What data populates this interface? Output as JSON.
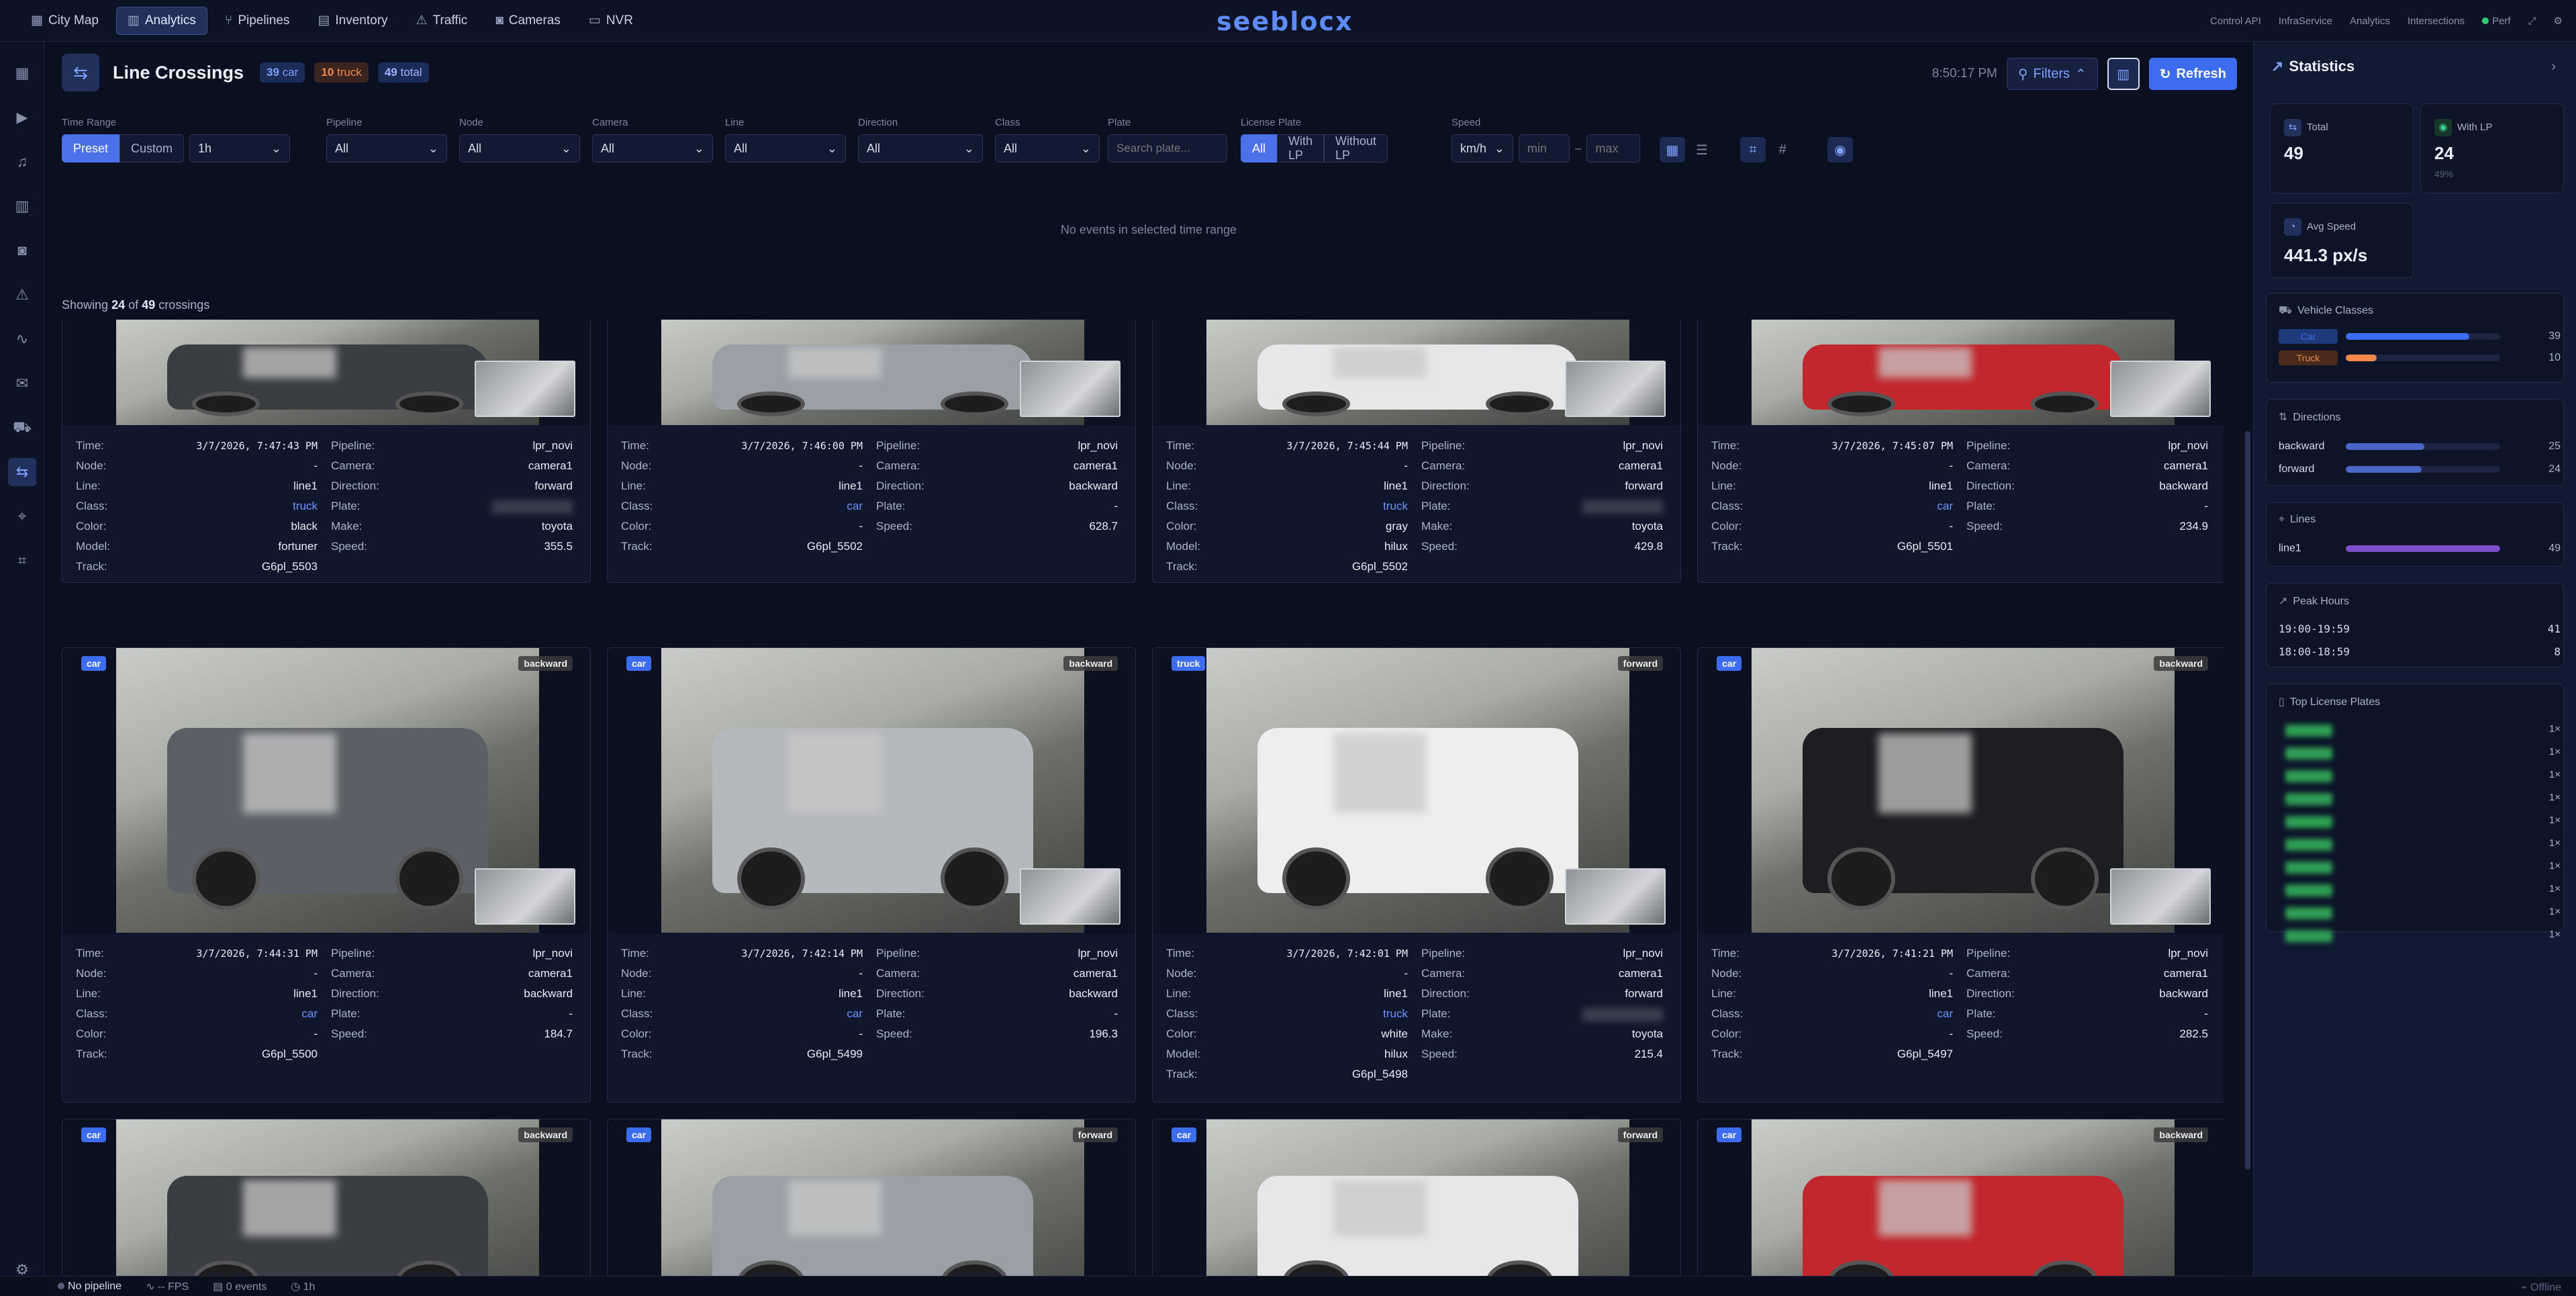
{
  "nav": {
    "items": [
      {
        "label": "City Map",
        "icon": "map-icon"
      },
      {
        "label": "Analytics",
        "icon": "chart-icon",
        "active": true
      },
      {
        "label": "Pipelines",
        "icon": "pipeline-icon"
      },
      {
        "label": "Inventory",
        "icon": "inventory-icon"
      },
      {
        "label": "Traffic",
        "icon": "traffic-icon"
      },
      {
        "label": "Cameras",
        "icon": "camera-icon"
      },
      {
        "label": "NVR",
        "icon": "nvr-icon"
      }
    ],
    "logo": "seeblocx",
    "right_links": [
      "Control API",
      "InfraService",
      "Analytics",
      "Intersections"
    ],
    "perf": "Perf"
  },
  "header": {
    "title": "Line Crossings",
    "car_count": "39",
    "car_label": "car",
    "truck_count": "10",
    "truck_label": "truck",
    "total_count": "49",
    "total_label": "total",
    "clock": "8:50:17 PM",
    "filters_label": "Filters",
    "refresh_label": "Refresh"
  },
  "filters": {
    "time_range_label": "Time Range",
    "preset_label": "Preset",
    "custom_label": "Custom",
    "range_value": "1h",
    "pipeline_label": "Pipeline",
    "pipeline_value": "All",
    "node_label": "Node",
    "node_value": "All",
    "camera_label": "Camera",
    "camera_value": "All",
    "line_label": "Line",
    "line_value": "All",
    "direction_label": "Direction",
    "direction_value": "All",
    "class_label": "Class",
    "class_value": "All",
    "plate_label": "Plate",
    "plate_placeholder": "Search plate...",
    "lp_label": "License Plate",
    "lp_all": "All",
    "lp_with": "With LP",
    "lp_without": "Without LP",
    "speed_label": "Speed",
    "speed_unit": "km/h",
    "speed_min": "min",
    "speed_dash": "–",
    "speed_max": "max"
  },
  "empty_message": "No events in selected time range",
  "showing": {
    "prefix": "Showing",
    "shown": "24",
    "of": "of",
    "total": "49",
    "suffix": "crossings"
  },
  "field_labels": {
    "time": "Time:",
    "node": "Node:",
    "line": "Line:",
    "class": "Class:",
    "color": "Color:",
    "model": "Model:",
    "track": "Track:",
    "pipeline": "Pipeline:",
    "camera": "Camera:",
    "direction": "Direction:",
    "plate": "Plate:",
    "make": "Make:",
    "speed": "Speed:"
  },
  "cards_row1": [
    {
      "time": "3/7/2026, 7:47:43 PM",
      "node": "-",
      "line": "line1",
      "class": "truck",
      "color": "black",
      "model": "fortuner",
      "track": "G6pl_5503",
      "pipeline": "lpr_novi",
      "camera": "camera1",
      "direction": "forward",
      "plate": "",
      "make": "toyota",
      "speed": "355.5"
    },
    {
      "time": "3/7/2026, 7:46:00 PM",
      "node": "-",
      "line": "line1",
      "class": "car",
      "color": "-",
      "track": "G6pl_5502",
      "pipeline": "lpr_novi",
      "camera": "camera1",
      "direction": "backward",
      "plate": "-",
      "speed": "628.7"
    },
    {
      "time": "3/7/2026, 7:45:44 PM",
      "node": "-",
      "line": "line1",
      "class": "truck",
      "color": "gray",
      "model": "hilux",
      "track": "G6pl_5502",
      "pipeline": "lpr_novi",
      "camera": "camera1",
      "direction": "forward",
      "plate": "",
      "make": "toyota",
      "speed": "429.8"
    },
    {
      "time": "3/7/2026, 7:45:07 PM",
      "node": "-",
      "line": "line1",
      "class": "car",
      "color": "-",
      "track": "G6pl_5501",
      "pipeline": "lpr_novi",
      "camera": "camera1",
      "direction": "backward",
      "plate": "-",
      "speed": "234.9"
    }
  ],
  "cards_row2": [
    {
      "badge": "car",
      "dir": "backward",
      "time": "3/7/2026, 7:44:31 PM",
      "node": "-",
      "line": "line1",
      "class": "car",
      "color": "-",
      "track": "G6pl_5500",
      "pipeline": "lpr_novi",
      "camera": "camera1",
      "direction": "backward",
      "plate": "-",
      "speed": "184.7"
    },
    {
      "badge": "car",
      "dir": "backward",
      "time": "3/7/2026, 7:42:14 PM",
      "node": "-",
      "line": "line1",
      "class": "car",
      "color": "-",
      "track": "G6pl_5499",
      "pipeline": "lpr_novi",
      "camera": "camera1",
      "direction": "backward",
      "plate": "-",
      "speed": "196.3"
    },
    {
      "badge": "truck",
      "dir": "forward",
      "time": "3/7/2026, 7:42:01 PM",
      "node": "-",
      "line": "line1",
      "class": "truck",
      "color": "white",
      "model": "hilux",
      "track": "G6pl_5498",
      "pipeline": "lpr_novi",
      "camera": "camera1",
      "direction": "forward",
      "plate": "",
      "make": "toyota",
      "speed": "215.4"
    },
    {
      "badge": "car",
      "dir": "backward",
      "time": "3/7/2026, 7:41:21 PM",
      "node": "-",
      "line": "line1",
      "class": "car",
      "color": "-",
      "track": "G6pl_5497",
      "pipeline": "lpr_novi",
      "camera": "camera1",
      "direction": "backward",
      "plate": "-",
      "speed": "282.5"
    }
  ],
  "cards_row3": [
    {
      "badge": "car",
      "dir": "backward"
    },
    {
      "badge": "car",
      "dir": "forward"
    },
    {
      "badge": "car",
      "dir": "forward"
    },
    {
      "badge": "car",
      "dir": "backward"
    }
  ],
  "stats": {
    "title": "Statistics",
    "total_label": "Total",
    "total_value": "49",
    "with_lp_label": "With LP",
    "with_lp_value": "24",
    "with_lp_pct": "49%",
    "avg_speed_label": "Avg Speed",
    "avg_speed_value": "441.3 px/s",
    "classes_title": "Vehicle Classes",
    "classes": [
      {
        "name": "Car",
        "value": "39",
        "fraction": 0.8,
        "color": "#3c6df0"
      },
      {
        "name": "Truck",
        "value": "10",
        "fraction": 0.2,
        "color": "#f0884a"
      }
    ],
    "directions_title": "Directions",
    "directions": [
      {
        "name": "backward",
        "value": "25",
        "fraction": 0.51
      },
      {
        "name": "forward",
        "value": "24",
        "fraction": 0.49
      }
    ],
    "lines_title": "Lines",
    "lines": [
      {
        "name": "line1",
        "value": "49",
        "fraction": 1.0
      }
    ],
    "peak_title": "Peak Hours",
    "peaks": [
      {
        "range": "19:00-19:59",
        "value": "41"
      },
      {
        "range": "18:00-18:59",
        "value": "8"
      }
    ],
    "plates_title": "Top License Plates",
    "plate_counts": [
      "1×",
      "1×",
      "1×",
      "1×",
      "1×",
      "1×",
      "1×",
      "1×",
      "1×",
      "1×"
    ]
  },
  "statusbar": {
    "pipeline": "No pipeline",
    "fps": "-- FPS",
    "events": "0 events",
    "range": "1h",
    "offline": "Offline"
  }
}
